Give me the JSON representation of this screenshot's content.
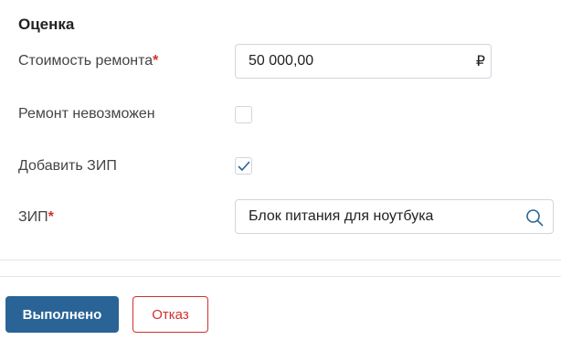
{
  "section": {
    "title": "Оценка"
  },
  "fields": {
    "repair_cost": {
      "label": "Стоимость ремонта",
      "required_mark": "*",
      "value": "50 000,00",
      "currency": "₽"
    },
    "repair_impossible": {
      "label": "Ремонт невозможен",
      "checked": false
    },
    "add_spare_parts": {
      "label": "Добавить ЗИП",
      "checked": true
    },
    "spare_parts": {
      "label": "ЗИП",
      "required_mark": "*",
      "value": "Блок питания для ноутбука",
      "icon": "search-icon"
    }
  },
  "actions": {
    "done_label": "Выполнено",
    "reject_label": "Отказ"
  },
  "colors": {
    "primary": "#2a6496",
    "danger": "#d0312d",
    "border": "#cfd6dd",
    "check": "#2a6496"
  }
}
